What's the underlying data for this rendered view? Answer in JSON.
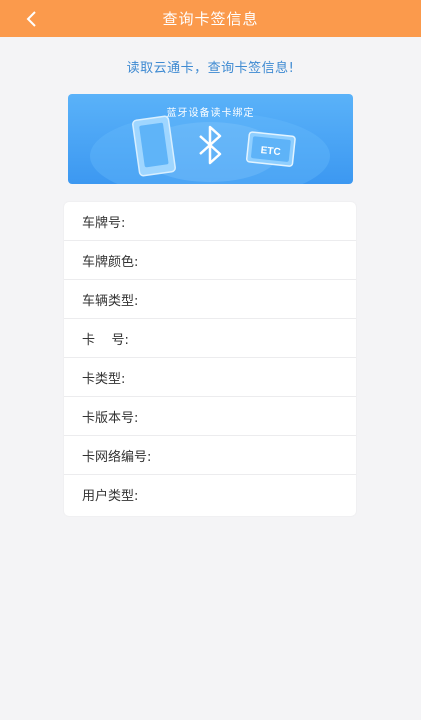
{
  "header": {
    "title": "查询卡签信息",
    "back_icon": "chevron-left-icon",
    "color": "#fb9a4c"
  },
  "prompt": {
    "text": "读取云通卡，查询卡签信息!",
    "color": "#3e8ad2"
  },
  "banner": {
    "caption": "蓝牙设备读卡绑定",
    "tag_text": "ETC",
    "icon": "bluetooth-icon",
    "color": "#4aa6f6"
  },
  "info": {
    "rows": [
      {
        "label": "车牌号:",
        "value": ""
      },
      {
        "label": "车牌颜色:",
        "value": ""
      },
      {
        "label": "车辆类型:",
        "value": ""
      },
      {
        "label": "卡    号:",
        "value": ""
      },
      {
        "label": "卡类型:",
        "value": ""
      },
      {
        "label": "卡版本号:",
        "value": ""
      },
      {
        "label": "卡网络编号:",
        "value": ""
      },
      {
        "label": "用户类型:",
        "value": ""
      }
    ]
  }
}
